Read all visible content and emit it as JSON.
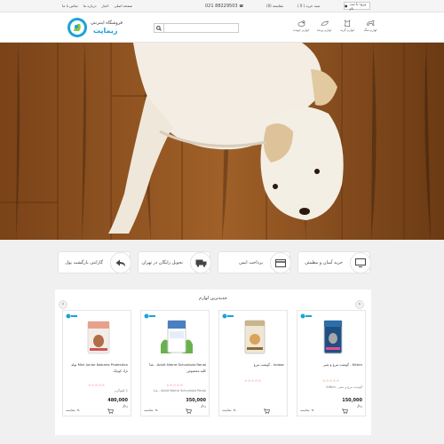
{
  "topbar": {
    "login_label": "ورود یا ثبت نام",
    "cart_label": "سبد خرید ( 0 )",
    "compare_label": "مقایسه (0)",
    "phone": "021 88229503",
    "links": [
      "صفحه اصلی",
      "اخبار",
      "درباره ما",
      "تماس با ما"
    ]
  },
  "header": {
    "categories": [
      "لوازم سگ",
      "لوازم گربه",
      "لوازم پرنده",
      "لوازم جونده"
    ],
    "search_placeholder": "",
    "logo_title": "فروشگاه اینترنتی",
    "logo_brand": "زیماپت"
  },
  "features": [
    {
      "label": "خرید آسان و مطمئن",
      "icon": "monitor-icon"
    },
    {
      "label": "پرداخت ایمن",
      "icon": "credit-card-icon"
    },
    {
      "label": "تحویل رایگان در تهران",
      "icon": "truck-icon"
    },
    {
      "label": "گارانتی بازگشت پول",
      "icon": "return-arrow-icon"
    }
  ],
  "products_section": {
    "heading": "جدیدترین لوازم",
    "products": [
      {
        "name": "Mini Junior Natures Protection توله",
        "sub": "نژاد کوچک",
        "stars": "☆☆☆☆☆",
        "extra": "1 کیلوگرم",
        "price": "480,000",
        "unit": "ریال",
        "compare": "مقایسه",
        "color": "#e8a08c"
      },
      {
        "name": "Adult Nierre Schunkost Renal - غذا",
        "sub": "کلیه مخصوص",
        "stars": "☆☆☆☆☆",
        "extra": "Adult Nierre Schunkost Renal - غذا",
        "price": "350,000",
        "unit": "ریال",
        "compare": "مقایسه",
        "color": "#4a7fc1"
      },
      {
        "name": "Indoor - گوشت مرغ",
        "sub": "",
        "stars": "☆☆☆☆☆",
        "extra": "",
        "price": "",
        "unit": "",
        "compare": "مقایسه",
        "color": "#d9c8a8"
      },
      {
        "name": "Kitten - گوشت مرغ و شیر",
        "sub": "",
        "stars": "☆☆☆☆☆",
        "extra": "گوشت مرغ و شیر - Kitten",
        "price": "150,000",
        "unit": "ریال",
        "compare": "مقایسه",
        "color": "#2c6fa8"
      }
    ]
  }
}
